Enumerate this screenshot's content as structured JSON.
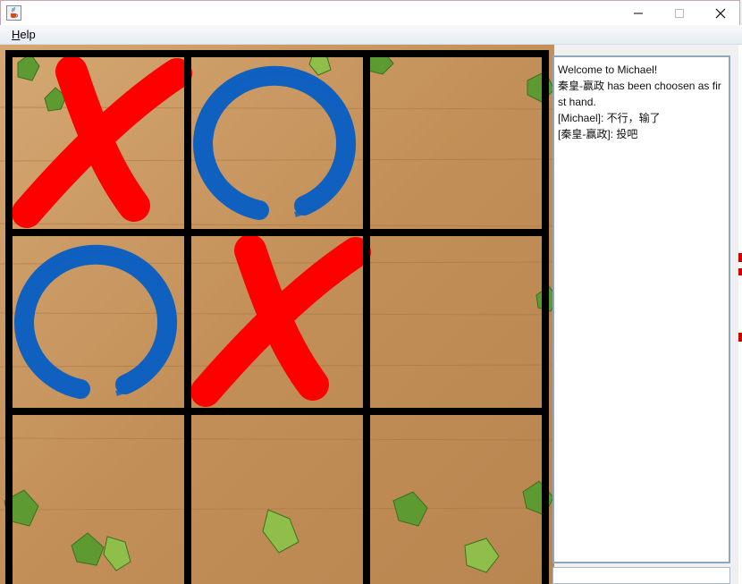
{
  "window": {
    "icon": "java-cup-icon",
    "buttons": [
      "minimize-icon",
      "maximize-icon",
      "close-icon"
    ]
  },
  "menu": {
    "items": [
      {
        "label": "Help"
      }
    ]
  },
  "board": {
    "rows": 3,
    "cols": 3,
    "cells": [
      [
        "X",
        "O",
        ""
      ],
      [
        "O",
        "X",
        ""
      ],
      [
        "",
        "",
        ""
      ]
    ],
    "colors": {
      "x": "#ff0000",
      "o": "#1060c0",
      "grid": "#000000",
      "wood": "#c99a62"
    }
  },
  "chat": {
    "lines": [
      "Welcome to Michael!",
      "秦皇-赢政 has been choosen as first hand.",
      "[Michael]: 不行，输了",
      "[秦皇-赢政]: 投吧"
    ],
    "input_value": ""
  }
}
